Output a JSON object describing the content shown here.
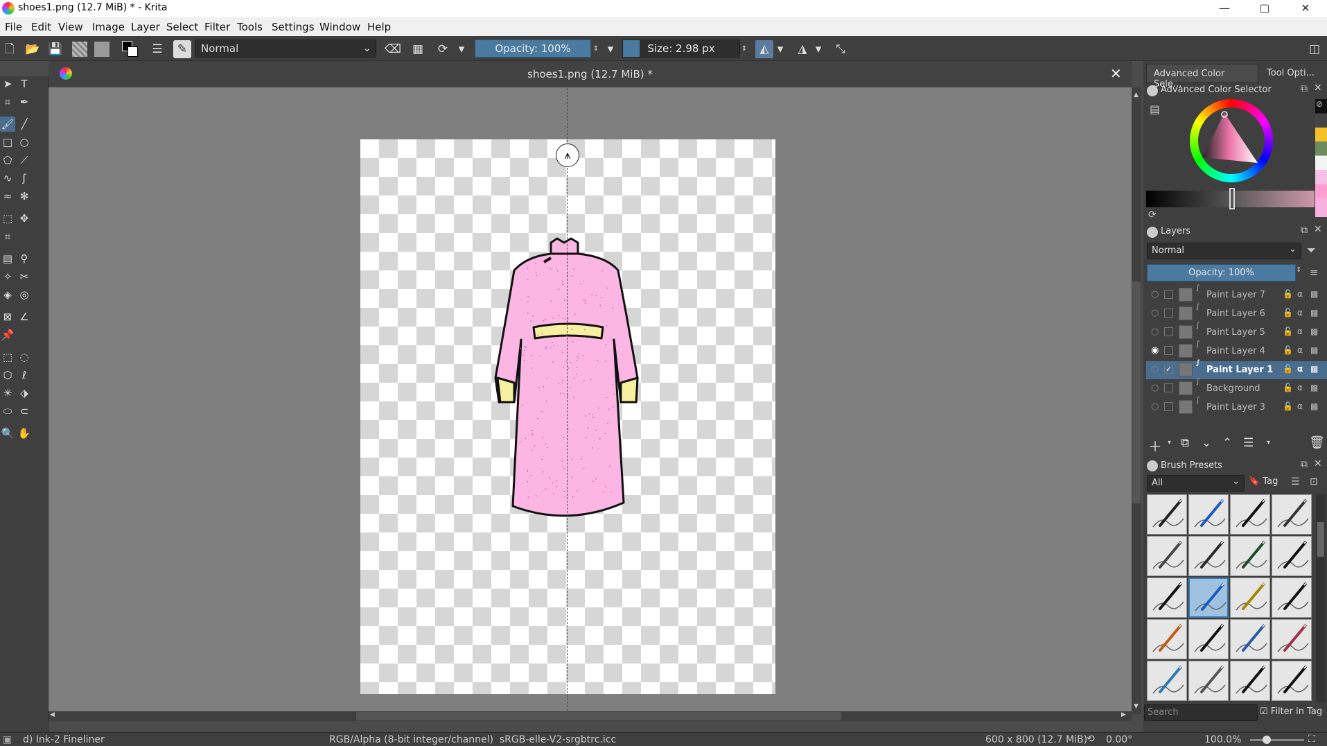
{
  "window": {
    "title": "shoes1.png (12.7 MiB) * - Krita",
    "minimize": "—",
    "maximize": "▢",
    "close": "✕"
  },
  "menu": [
    "File",
    "Edit",
    "View",
    "Image",
    "Layer",
    "Select",
    "Filter",
    "Tools",
    "Settings",
    "Window",
    "Help"
  ],
  "toolbar": {
    "blend_mode": "Normal",
    "opacity": "Opacity: 100%",
    "size": "Size: 2.98 px"
  },
  "document": {
    "tab_title": "shoes1.png (12.7 MiB) *",
    "close": "✕"
  },
  "right_dock": {
    "tabs": [
      "Advanced Color Sele...",
      "Tool Opti..."
    ],
    "color_selector_title": "Advanced Color Selector",
    "layers_title": "Layers",
    "layers_blend": "Normal",
    "layers_opacity": "Opacity:  100%",
    "layers": [
      {
        "name": "Paint Layer 7",
        "visible": false,
        "selected": false
      },
      {
        "name": "Paint Layer 6",
        "visible": false,
        "selected": false
      },
      {
        "name": "Paint Layer 5",
        "visible": false,
        "selected": false
      },
      {
        "name": "Paint Layer 4",
        "visible": true,
        "selected": false
      },
      {
        "name": "Paint Layer 1",
        "visible": false,
        "selected": true
      },
      {
        "name": "Background",
        "visible": false,
        "selected": false
      },
      {
        "name": "Paint Layer 3",
        "visible": false,
        "selected": false
      }
    ],
    "brush_presets_title": "Brush Presets",
    "brush_filter": "All",
    "tag_label": "Tag",
    "search_placeholder": "Search",
    "filter_in_tag": "Filter in Tag"
  },
  "status": {
    "brush": "d) Ink-2 Fineliner",
    "colorspace": "RGB/Alpha (8-bit integer/channel)  sRGB-elle-V2-srgbtrc.icc",
    "dimensions": "600 x 800 (12.7 MiB)",
    "rotation": "0.00°",
    "zoom": "100.0%"
  },
  "colors": {
    "accent": "#4a7aa0",
    "dress": "#fbb6e4",
    "sash": "#f7f0a0"
  }
}
